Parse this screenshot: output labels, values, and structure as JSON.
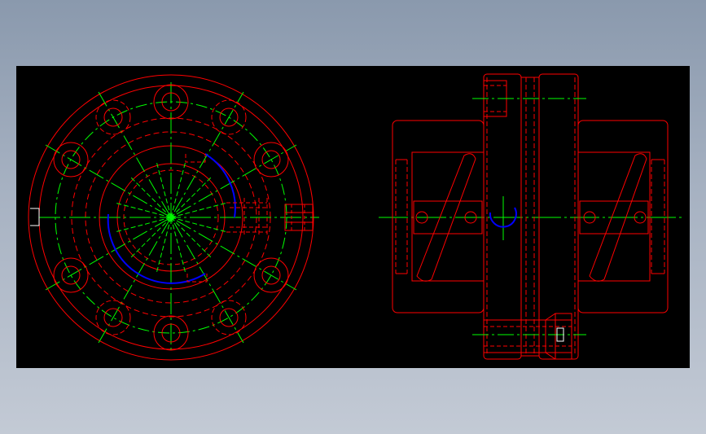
{
  "drawing": {
    "title": "",
    "colors": {
      "background": "#000000",
      "outline": "#ff0000",
      "hidden": "#ff0000",
      "centerline": "#00ff00",
      "highlight": "#0000ff",
      "detail": "#ffffff"
    },
    "views": [
      "front-view",
      "side-view"
    ]
  }
}
